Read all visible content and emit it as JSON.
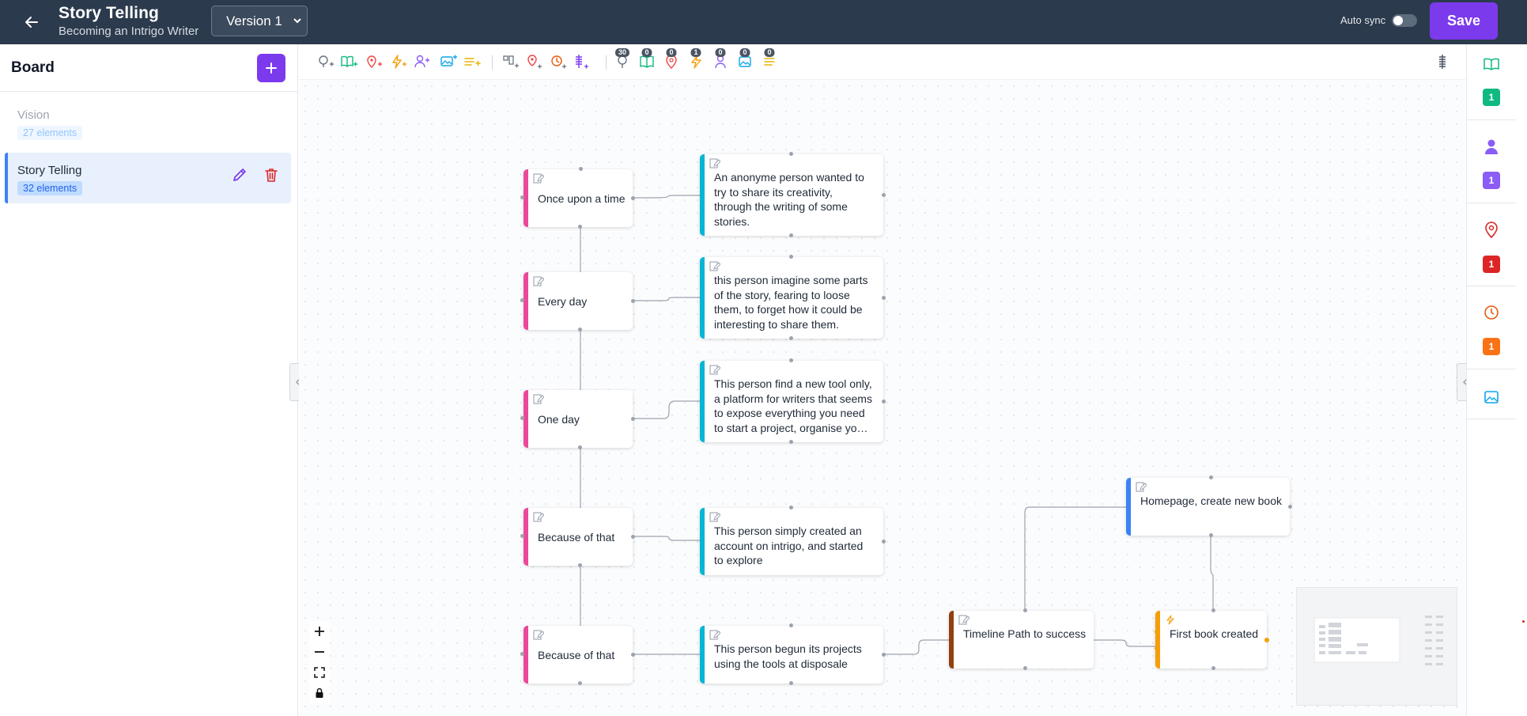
{
  "header": {
    "title": "Story Telling",
    "subtitle": "Becoming an Intrigo Writer",
    "version": "Version 1",
    "autosync_label": "Auto sync",
    "save_label": "Save"
  },
  "sidebar": {
    "title": "Board",
    "boards": [
      {
        "name": "Vision",
        "count": "27 elements"
      },
      {
        "name": "Story Telling",
        "count": "32 elements"
      }
    ]
  },
  "toolbar": {
    "badges": {
      "ideas": "30",
      "books": "0",
      "places": "0",
      "events": "1",
      "characters": "0",
      "images": "0",
      "notes": "0"
    }
  },
  "nodes": {
    "n1": "Once upon a time",
    "n2": "Every day",
    "n3": "One day",
    "n4": "Because of that",
    "n5": "Because of that",
    "m1": "An anonyme person wanted to try to share its creativity, through the writing of some stories.",
    "m2": "this person imagine some parts of the story, fearing to loose them, to forget how it could be interesting to share  them.",
    "m3": "This person find a new tool only, a platform for writers that seems to expose everything you need to start a project, organise your ideas",
    "m4": "This person simply created an account on intrigo, and started to explore",
    "m5": "This person begun its projects using the tools at disposale",
    "t1": "Timeline Path to success",
    "h1": "Homepage, create new book",
    "e1": "First book created"
  },
  "right_rail": {
    "books": "1",
    "characters": "1",
    "places": "1",
    "timeline": "1"
  },
  "colors": {
    "header_bg": "#2b3a4c",
    "accent": "#7c3aed",
    "pink": "#ec4899",
    "cyan": "#06b6d4",
    "brown": "#92400e",
    "blue": "#3b82f6",
    "amber": "#f59e0b",
    "green": "#10b981",
    "purple": "#8b5cf6",
    "red": "#dc2626",
    "orange": "#f97316"
  }
}
